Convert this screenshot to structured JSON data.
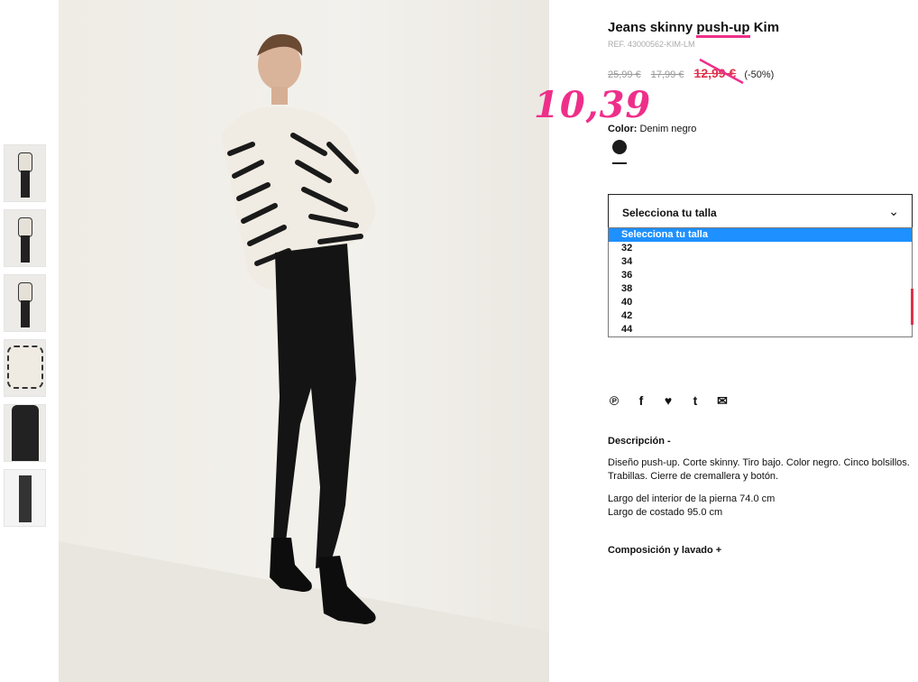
{
  "product": {
    "title_pre": "Jeans skinny ",
    "title_mid": "push-up",
    "title_post": " Kim",
    "ref": "REF. 43000562-KIM-LM",
    "old_price_1": "25,99 €",
    "old_price_2": "17,99 €",
    "sale_price": "12,99 €",
    "discount": "(-50%)",
    "handwritten_price": "10,39",
    "color_label": "Color:",
    "color_value": "Denim negro"
  },
  "size_select": {
    "value": "Selecciona tu talla",
    "options": [
      "Selecciona tu talla",
      "32",
      "34",
      "36",
      "38",
      "40",
      "42",
      "44"
    ]
  },
  "share": {
    "icons": [
      "pinterest-icon",
      "facebook-icon",
      "twitter-icon",
      "tumblr-icon",
      "mail-icon"
    ],
    "glyphs": [
      "𝙿",
      "f",
      "🐦",
      "t",
      "✉"
    ]
  },
  "description": {
    "heading": "Descripción -",
    "text1": "Diseño push-up. Corte skinny. Tiro bajo. Color negro. Cinco bolsillos. Trabillas. Cierre de cremallera y botón.",
    "text2": "Largo del interior de la pierna 74.0 cm",
    "text3": "Largo de costado 95.0 cm"
  },
  "composition": {
    "heading": "Composición y lavado +"
  },
  "colors": {
    "sale": "#e0314b",
    "annotation": "#ee2f8a",
    "selected_option": "#1e90ff"
  }
}
